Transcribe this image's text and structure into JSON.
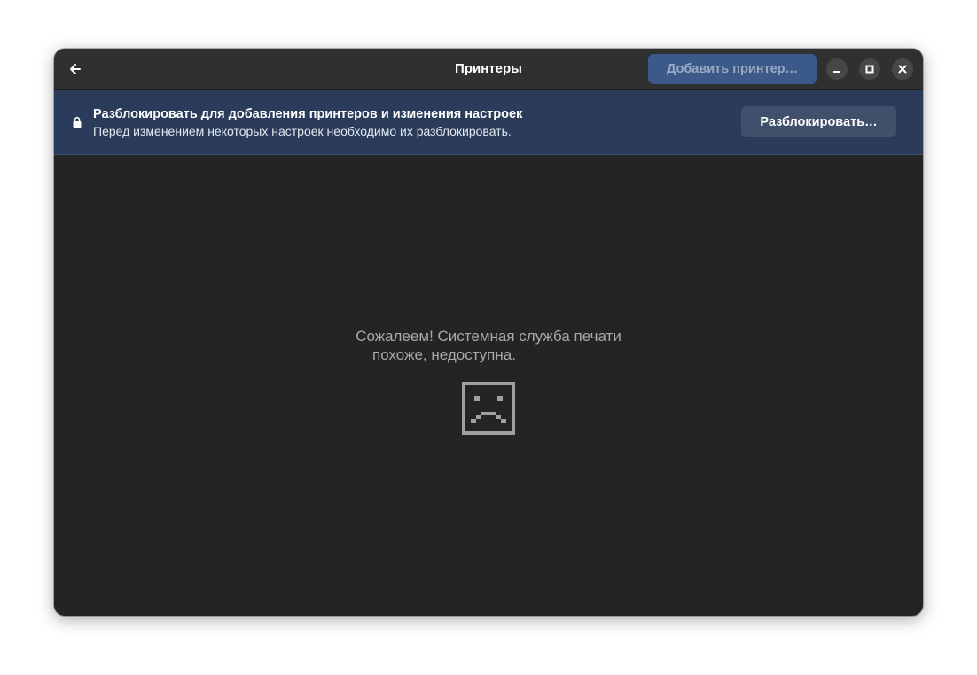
{
  "header": {
    "title": "Принтеры",
    "add_button_label": "Добавить принтер…"
  },
  "infobar": {
    "title": "Разблокировать для добавления принтеров и изменения настроек",
    "subtitle": "Перед изменением некоторых настроек необходимо их разблокировать.",
    "unlock_button_label": "Разблокировать…"
  },
  "main": {
    "message_line1": "Сожалеем! Системная служба печати",
    "message_line2": "похоже, недоступна."
  },
  "icons": {
    "back": "back-arrow-icon",
    "minimize": "minimize-icon",
    "maximize": "maximize-icon",
    "close": "close-icon",
    "lock": "lock-icon",
    "sad_face": "sad-face-icon"
  },
  "colors": {
    "window_bg": "#242424",
    "headerbar_bg": "#303030",
    "infobar_bg": "#2a3c5a",
    "accent_disabled": "#3b5a8a",
    "message_text": "#a8a8a8"
  }
}
